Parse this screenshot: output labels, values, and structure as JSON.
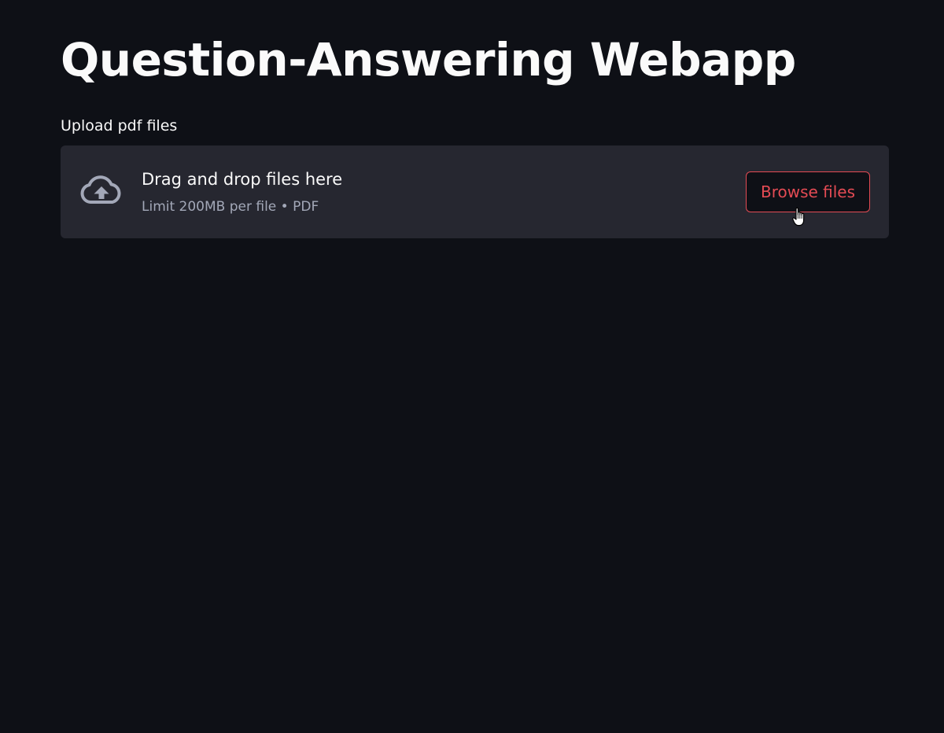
{
  "app": {
    "title": "Question-Answering Webapp"
  },
  "uploader": {
    "label": "Upload pdf files",
    "dropzone_title": "Drag and drop files here",
    "dropzone_subtitle": "Limit 200MB per file • PDF",
    "browse_label": "Browse files",
    "icon": "cloud-upload-icon"
  },
  "colors": {
    "background": "#0e1016",
    "dropzone_background": "#262730",
    "accent": "#e44b54",
    "text": "#fafafa",
    "muted_text": "#a3a8b8",
    "icon": "#a3a8b8"
  }
}
